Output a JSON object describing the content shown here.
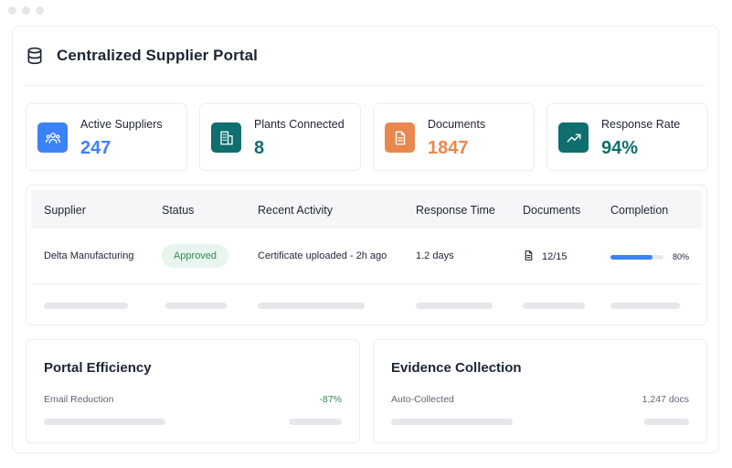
{
  "colors": {
    "blue": "#3b82f6",
    "teal": "#0f6e6e",
    "orange": "#e8884f",
    "green": "#2f8a54",
    "muted": "#5f6775"
  },
  "header": {
    "icon": "database-icon",
    "title": "Centralized Supplier Portal"
  },
  "stats": [
    {
      "icon": "users-icon",
      "label": "Active Suppliers",
      "value": "247",
      "color": "#3b82f6"
    },
    {
      "icon": "building-icon",
      "label": "Plants Connected",
      "value": "8",
      "color": "#0f6e6e"
    },
    {
      "icon": "document-icon",
      "label": "Documents",
      "value": "1847",
      "color": "#e8884f"
    },
    {
      "icon": "trending-up-icon",
      "label": "Response Rate",
      "value": "94%",
      "color": "#0f6e6e"
    }
  ],
  "table": {
    "columns": [
      "Supplier",
      "Status",
      "Recent Activity",
      "Response Time",
      "Documents",
      "Completion"
    ],
    "rows": [
      {
        "supplier": "Delta Manufacturing",
        "status": "Approved",
        "activity": "Certificate uploaded - 2h ago",
        "response_time": "1.2 days",
        "documents": "12/15",
        "completion_label": "80%",
        "completion": 0.8
      }
    ]
  },
  "cards": {
    "efficiency": {
      "title": "Portal Efficiency",
      "label": "Email Reduction",
      "value": "-87%"
    },
    "evidence": {
      "title": "Evidence Collection",
      "label": "Auto-Collected",
      "value": "1,247 docs"
    }
  }
}
